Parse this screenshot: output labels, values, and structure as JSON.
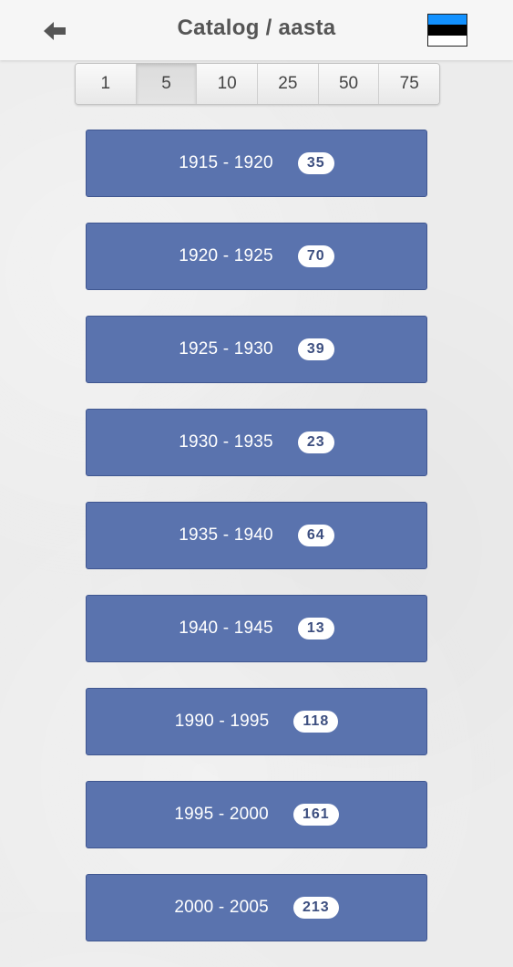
{
  "header": {
    "title": "Catalog / aasta",
    "back_icon": "arrow-left-icon",
    "flag": {
      "icon": "estonia-flag-icon",
      "colors": [
        "#1291FF",
        "#000000",
        "#FFFFFF"
      ]
    }
  },
  "interval_selector": {
    "options": [
      "1",
      "5",
      "10",
      "25",
      "50",
      "75"
    ],
    "selected": "5"
  },
  "ranges": [
    {
      "label": "1915 - 1920",
      "count": "35"
    },
    {
      "label": "1920 - 1925",
      "count": "70"
    },
    {
      "label": "1925 - 1930",
      "count": "39"
    },
    {
      "label": "1930 - 1935",
      "count": "23"
    },
    {
      "label": "1935 - 1940",
      "count": "64"
    },
    {
      "label": "1940 - 1945",
      "count": "13"
    },
    {
      "label": "1990 - 1995",
      "count": "118"
    },
    {
      "label": "1995 - 2000",
      "count": "161"
    },
    {
      "label": "2000 - 2005",
      "count": "213"
    }
  ],
  "colors": {
    "button_bg": "#5A73AE",
    "button_border": "#3F5690",
    "badge_text": "#3D4F80",
    "title_text": "#555555"
  }
}
